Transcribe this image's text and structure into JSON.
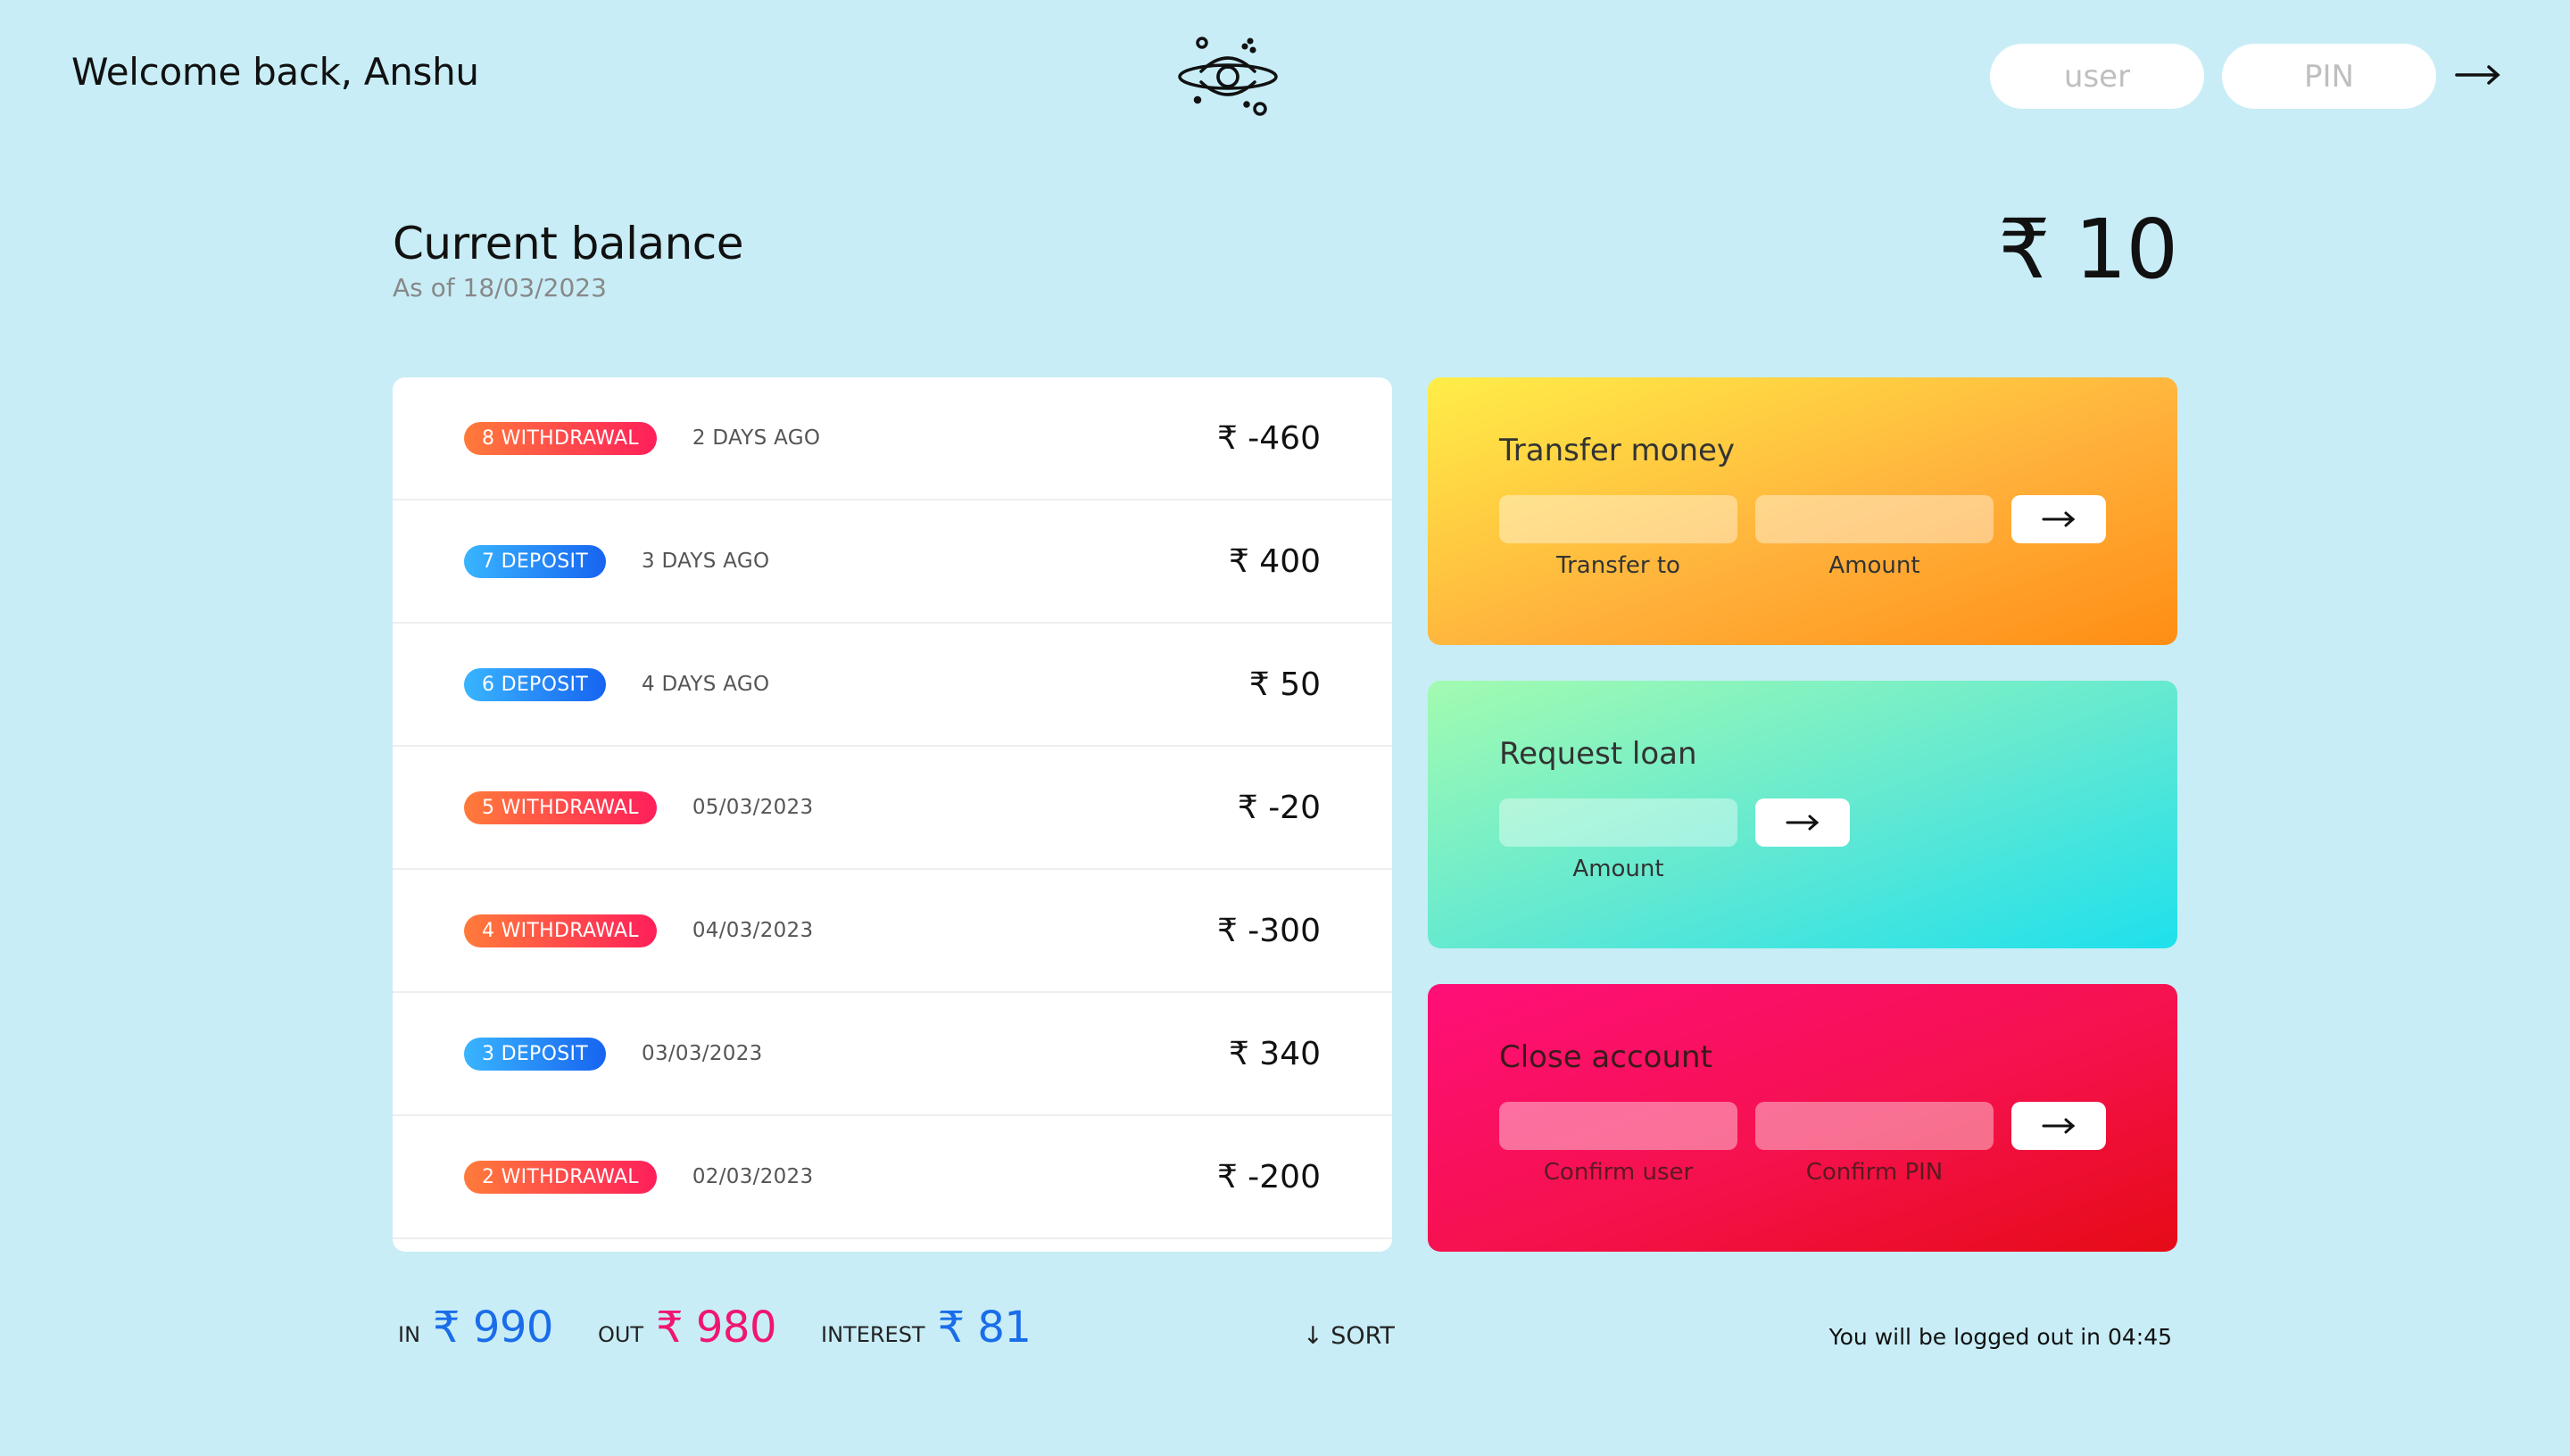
{
  "nav": {
    "welcome": "Welcome back, Anshu",
    "user_placeholder": "user",
    "pin_placeholder": "PIN",
    "login_arrow": "→"
  },
  "balance": {
    "title": "Current balance",
    "date_prefix": "As of",
    "date": "18/03/2023",
    "value": "₹ 10"
  },
  "movements": [
    {
      "index": "8",
      "type": "withdrawal",
      "type_label": "8 WITHDRAWAL",
      "date": "2 DAYS AGO",
      "value": "₹ -460"
    },
    {
      "index": "7",
      "type": "deposit",
      "type_label": "7 DEPOSIT",
      "date": "3 DAYS AGO",
      "value": "₹ 400"
    },
    {
      "index": "6",
      "type": "deposit",
      "type_label": "6 DEPOSIT",
      "date": "4 DAYS AGO",
      "value": "₹ 50"
    },
    {
      "index": "5",
      "type": "withdrawal",
      "type_label": "5 WITHDRAWAL",
      "date": "05/03/2023",
      "value": "₹ -20"
    },
    {
      "index": "4",
      "type": "withdrawal",
      "type_label": "4 WITHDRAWAL",
      "date": "04/03/2023",
      "value": "₹ -300"
    },
    {
      "index": "3",
      "type": "deposit",
      "type_label": "3 DEPOSIT",
      "date": "03/03/2023",
      "value": "₹ 340"
    },
    {
      "index": "2",
      "type": "withdrawal",
      "type_label": "2 WITHDRAWAL",
      "date": "02/03/2023",
      "value": "₹ -200"
    }
  ],
  "operations": {
    "transfer": {
      "title": "Transfer money",
      "label_to": "Transfer to",
      "label_amount": "Amount",
      "arrow": "→"
    },
    "loan": {
      "title": "Request loan",
      "label_amount": "Amount",
      "arrow": "→"
    },
    "close": {
      "title": "Close account",
      "label_user": "Confirm user",
      "label_pin": "Confirm PIN",
      "arrow": "→"
    }
  },
  "summary": {
    "in_label": "In",
    "in_value": "₹ 990",
    "out_label": "Out",
    "out_value": "₹ 980",
    "interest_label": "Interest",
    "interest_value": "₹ 81",
    "sort_label": "↓ SORT"
  },
  "logout_timer": {
    "text": "You will be logged out in",
    "time": "04:45"
  },
  "colors": {
    "background": "#c8edf6",
    "withdrawal": "#ff2f5a",
    "deposit": "#1d74f0",
    "in": "#1a6dea",
    "out": "#f01670"
  },
  "icons": {
    "logo": "planet-eye-logo-icon",
    "arrow": "arrow-right-icon"
  }
}
